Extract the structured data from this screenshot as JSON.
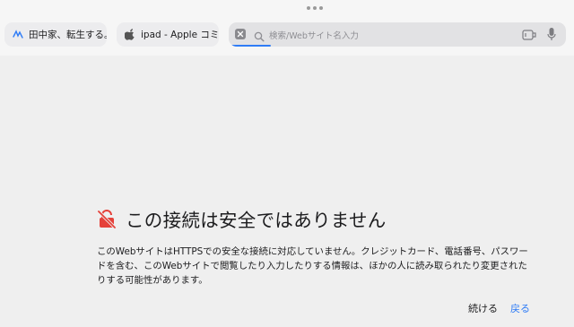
{
  "tabs": [
    {
      "title": "田中家、転生する。",
      "favicon": "tanaka-favicon"
    },
    {
      "title": "ipad - Apple コミュニ",
      "favicon": "apple-icon"
    }
  ],
  "address_bar": {
    "placeholder": "検索/Webサイト名入力",
    "progress": 0.12
  },
  "warning": {
    "title": "この接続は安全ではありません",
    "message": "このWebサイトはHTTPSでの安全な接続に対応していません。クレジットカード、電話番号、パスワードを含む、このWebサイトで閲覧したり入力したりする情報は、ほかの人に読み取られたり変更されたりする可能性があります。"
  },
  "actions": {
    "continue_label": "続ける",
    "back_label": "戻る"
  },
  "colors": {
    "accent": "#2f7cf6",
    "warning_icon": "#e5413a"
  }
}
